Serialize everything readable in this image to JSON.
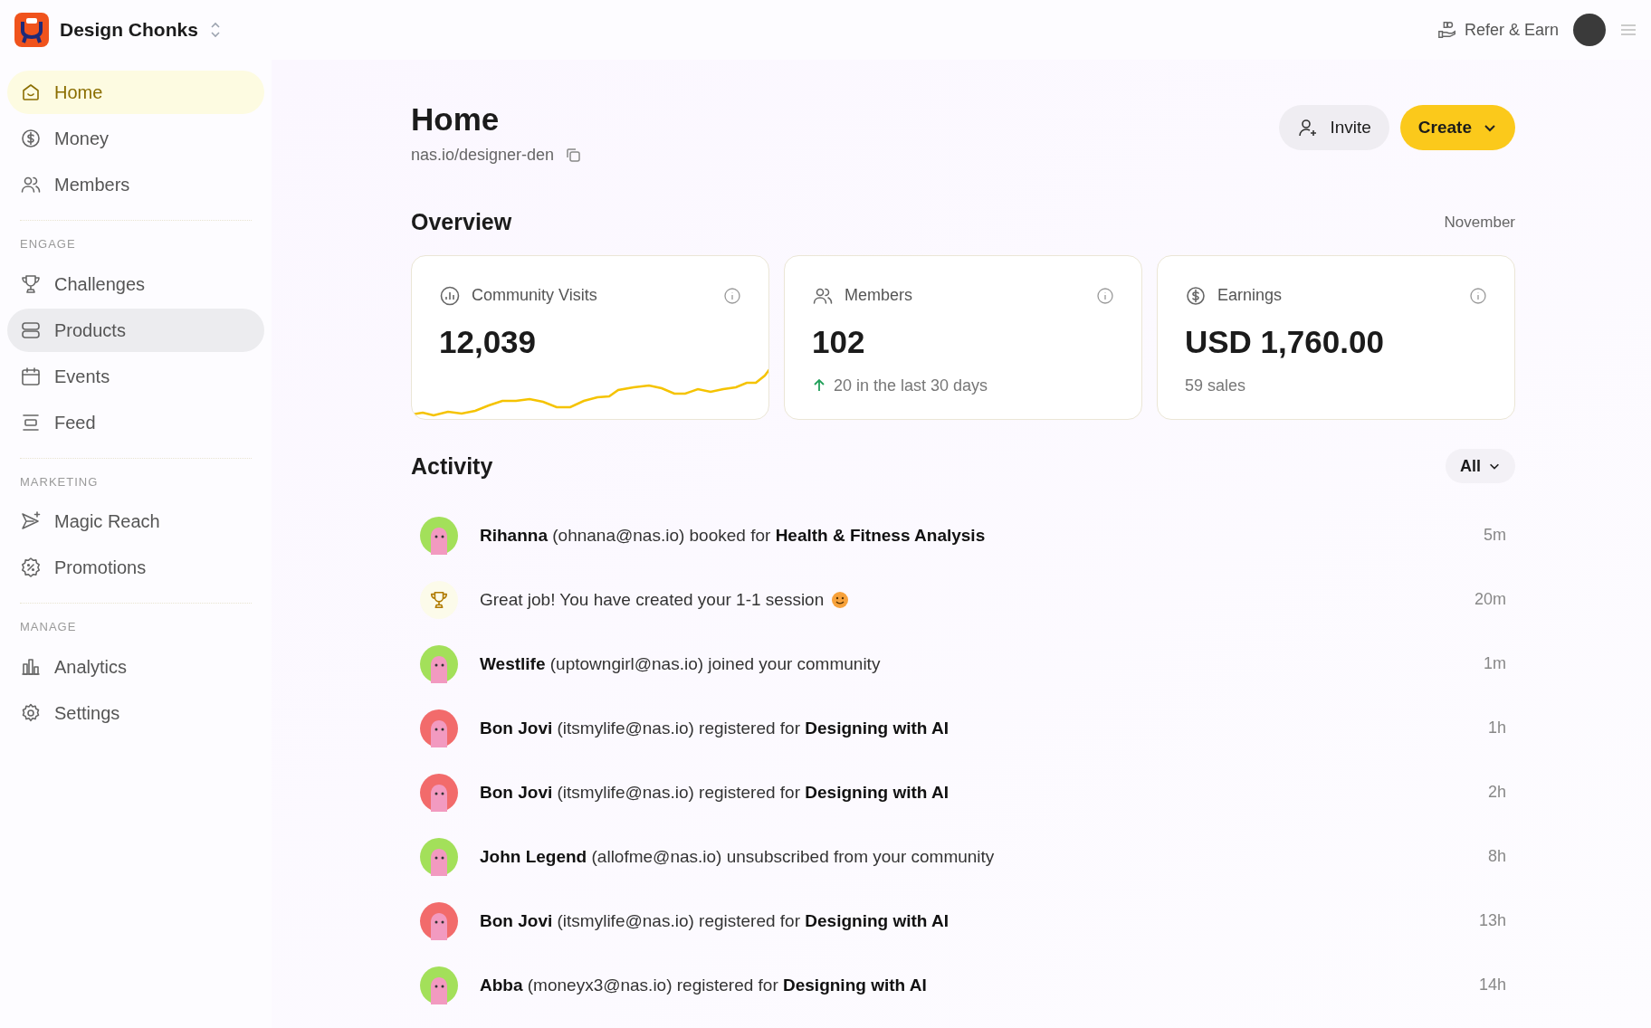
{
  "workspace": {
    "name": "Design Chonks"
  },
  "topbar": {
    "refer": "Refer & Earn"
  },
  "sidebar": {
    "sections": [
      {
        "items": [
          {
            "label": "Home",
            "kind": "home",
            "selected": true,
            "hovered": false
          },
          {
            "label": "Money",
            "kind": "money",
            "selected": false,
            "hovered": false
          },
          {
            "label": "Members",
            "kind": "members",
            "selected": false,
            "hovered": false
          }
        ]
      },
      {
        "heading": "ENGAGE",
        "items": [
          {
            "label": "Challenges",
            "kind": "trophy",
            "selected": false,
            "hovered": false
          },
          {
            "label": "Products",
            "kind": "products",
            "selected": false,
            "hovered": true
          },
          {
            "label": "Events",
            "kind": "calendar",
            "selected": false,
            "hovered": false
          },
          {
            "label": "Feed",
            "kind": "feed",
            "selected": false,
            "hovered": false
          }
        ]
      },
      {
        "heading": "MARKETING",
        "items": [
          {
            "label": "Magic Reach",
            "kind": "send",
            "selected": false,
            "hovered": false
          },
          {
            "label": "Promotions",
            "kind": "promo",
            "selected": false,
            "hovered": false
          }
        ]
      },
      {
        "heading": "MANAGE",
        "items": [
          {
            "label": "Analytics",
            "kind": "analytics",
            "selected": false,
            "hovered": false
          },
          {
            "label": "Settings",
            "kind": "settings",
            "selected": false,
            "hovered": false
          }
        ]
      }
    ]
  },
  "page": {
    "title": "Home",
    "url": "nas.io/designer-den",
    "buttons": [
      {
        "label": "Invite",
        "kind": "secondary"
      },
      {
        "label": "Create",
        "kind": "primary"
      }
    ]
  },
  "overview": {
    "title": "Overview",
    "period": "November",
    "cards": [
      {
        "kind": "visits",
        "label": "Community Visits",
        "value": "12,039"
      },
      {
        "kind": "members",
        "label": "Members",
        "value": "102",
        "note": "20 in the last 30 days"
      },
      {
        "kind": "earnings",
        "label": "Earnings",
        "value": "USD 1,760.00",
        "note": "59 sales"
      }
    ]
  },
  "activity": {
    "title": "Activity",
    "filter": "All",
    "items": [
      {
        "kind": "user",
        "color": "#a3e05a",
        "text": "**Rihanna** (ohnana@nas.io) booked for **Health & Fitness Analysis**",
        "time": "5m"
      },
      {
        "kind": "achievement",
        "text": "Great job! You have created your 1-1 session",
        "time": "20m"
      },
      {
        "kind": "user",
        "color": "#a3e05a",
        "text": "**Westlife** (uptowngirl@nas.io) joined your community",
        "time": "1m"
      },
      {
        "kind": "user",
        "color": "#f26b6b",
        "text": "**Bon Jovi** (itsmylife@nas.io) registered for **Designing with AI**",
        "time": "1h"
      },
      {
        "kind": "user",
        "color": "#f26b6b",
        "text": "**Bon Jovi** (itsmylife@nas.io) registered for **Designing with AI**",
        "time": "2h"
      },
      {
        "kind": "user",
        "color": "#a3e05a",
        "text": "**John Legend** (allofme@nas.io) unsubscribed from your community",
        "time": "8h"
      },
      {
        "kind": "user",
        "color": "#f26b6b",
        "text": "**Bon Jovi** (itsmylife@nas.io) registered for **Designing with AI**",
        "time": "13h"
      },
      {
        "kind": "user",
        "color": "#a3e05a",
        "text": "**Abba** (moneyx3@nas.io) registered for **Designing with AI**",
        "time": "14h"
      }
    ]
  }
}
